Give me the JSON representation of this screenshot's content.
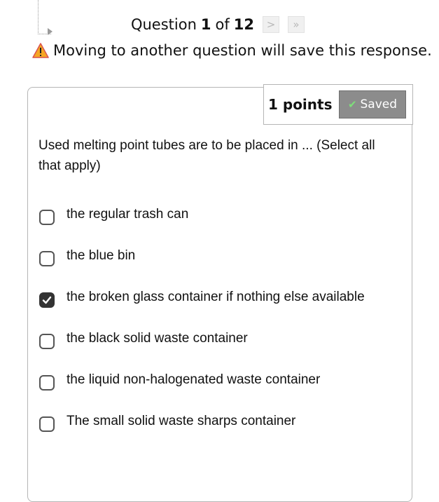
{
  "header": {
    "question_word": "Question",
    "current": "1",
    "of_word": "of",
    "total": "12",
    "next_glyph": ">",
    "last_glyph": "»"
  },
  "warning": {
    "icon": "warning-triangle-icon",
    "text": "Moving to another question will save this response."
  },
  "points": {
    "label": "1 points",
    "status": "Saved",
    "status_icon": "check-icon"
  },
  "question": {
    "text": "Used melting point tubes are to be placed in ... (Select all that apply)",
    "options": [
      {
        "label": "the regular trash can",
        "checked": false
      },
      {
        "label": "the blue bin",
        "checked": false
      },
      {
        "label": "the broken glass container if nothing else available",
        "checked": true
      },
      {
        "label": "the black solid waste container",
        "checked": false
      },
      {
        "label": "the liquid non-halogenated waste container",
        "checked": false
      },
      {
        "label": "The small solid waste sharps container",
        "checked": false
      }
    ]
  },
  "colors": {
    "warning_fill": "#f5a623",
    "saved_bg": "#8c8c8c",
    "checked_box": "#333333"
  }
}
